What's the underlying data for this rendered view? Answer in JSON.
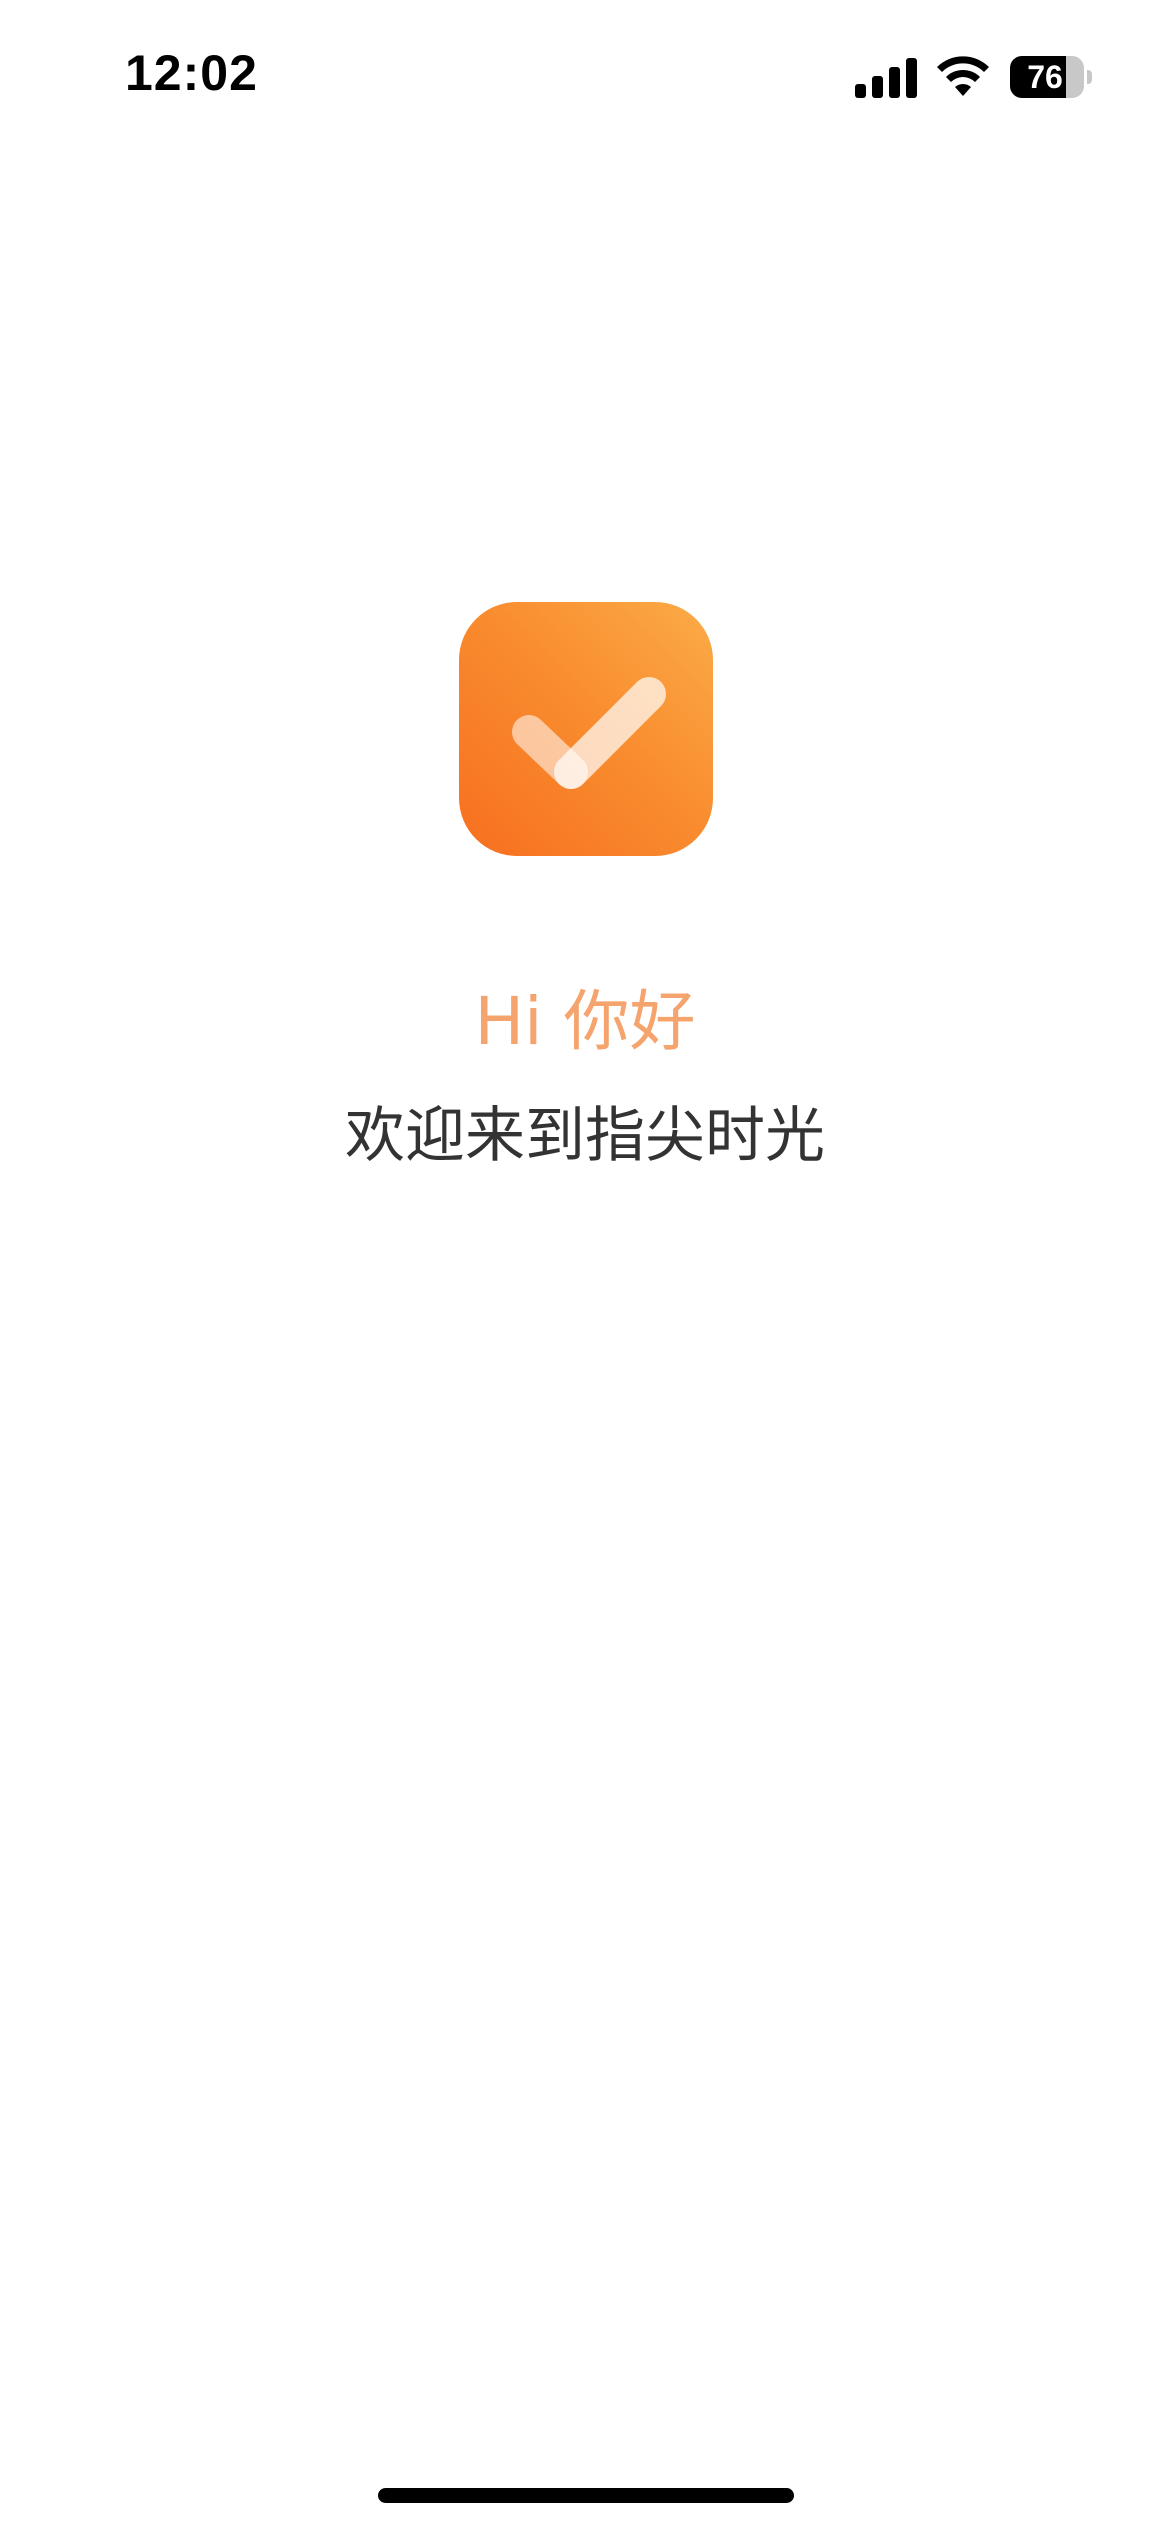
{
  "status_bar": {
    "time": "12:02",
    "battery_level_text": "76",
    "battery_level": 0.76,
    "icons": [
      "signal-icon",
      "wifi-icon",
      "battery-icon"
    ]
  },
  "app": {
    "logo_icon": "checkmark-icon",
    "logo_colors": {
      "gradient_start": "#fbac48",
      "gradient_end": "#f76f1f"
    }
  },
  "greeting": {
    "title": "Hi 你好",
    "subtitle": "欢迎来到指尖时光"
  },
  "colors": {
    "greeting": "#f5a46e",
    "subtitle": "#333333",
    "background": "#ffffff"
  }
}
